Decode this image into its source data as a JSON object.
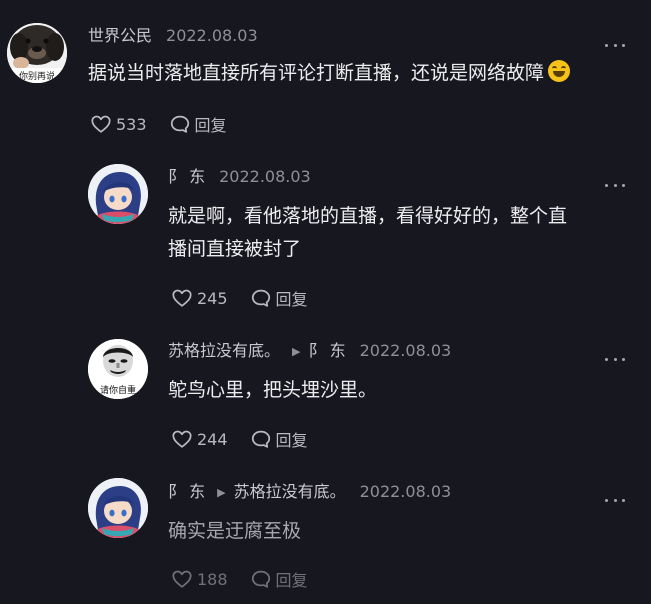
{
  "comments": [
    {
      "name": "世界公民",
      "date": "2022.08.03",
      "avatar_text": "你别再说",
      "text": "据说当时落地直接所有评论打断直播，还说是网络故障",
      "emoji": "laughing-tears-emoji",
      "likes": "533",
      "reply_label": "回复"
    },
    {
      "name": "阝 东",
      "date": "2022.08.03",
      "text_lines": [
        "就是啊，看他落地的直播，看得好好的，整个直",
        "播间直接被封了"
      ],
      "likes": "245",
      "reply_label": "回复"
    },
    {
      "name": "苏格拉没有底。",
      "reply_to": "阝 东",
      "date": "2022.08.03",
      "avatar_text": "请你自重",
      "text": "鸵鸟心里，把头埋沙里。",
      "likes": "244",
      "reply_label": "回复"
    },
    {
      "name": "阝 东",
      "reply_to": "苏格拉没有底。",
      "date": "2022.08.03",
      "text": "确实是迂腐至极",
      "likes": "188",
      "reply_label": "回复"
    }
  ],
  "colors": {
    "background": "#17171f",
    "text": "#ededf0",
    "secondary": "#a7a7ae"
  }
}
